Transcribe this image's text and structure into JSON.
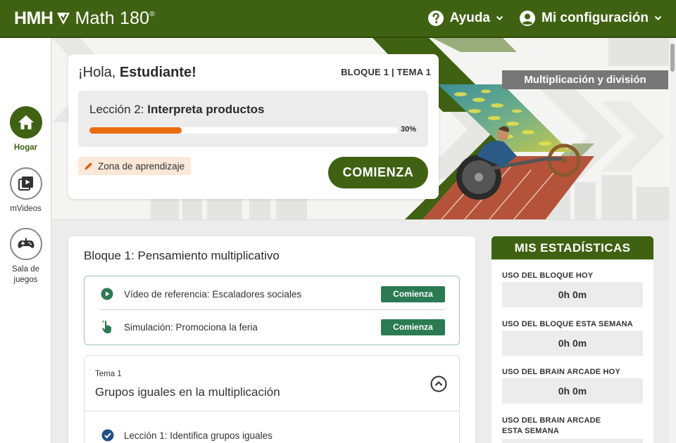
{
  "header": {
    "brand_hmh": "HMH",
    "brand_product": "Math 180",
    "brand_reg": "®",
    "help_label": "Ayuda",
    "settings_label": "Mi configuración"
  },
  "nav": {
    "items": [
      {
        "label": "Hogar",
        "icon": "home-icon"
      },
      {
        "label": "mVideos",
        "icon": "video-icon"
      },
      {
        "label": "Sala de juegos",
        "icon": "gamepad-icon"
      }
    ]
  },
  "hero": {
    "tag": "Multiplicación y división"
  },
  "welcome": {
    "greeting_prefix": "¡Hola, ",
    "student_name": "Estudiante!",
    "unit_topic": "BLOQUE 1 | TEMA 1",
    "lesson_prefix": "Lección 2: ",
    "lesson_name": "Interpreta productos",
    "progress": 30,
    "progress_label": "30%",
    "zone_label": "Zona de aprendizaje",
    "start_label": "COMIENZA"
  },
  "unit": {
    "title": "Bloque 1: Pensamiento multiplicativo",
    "references": [
      {
        "text": "Vídeo de referencia: Escaladores sociales",
        "button": "Comienza",
        "icon": "play-icon"
      },
      {
        "text": "Simulación: Promociona la feria",
        "button": "Comienza",
        "icon": "hand-pointer-icon"
      }
    ],
    "topic": {
      "number": "Tema 1",
      "name": "Grupos iguales en la multiplicación",
      "lessons": [
        {
          "text": "Lección 1: Identifica grupos iguales",
          "status": "complete"
        }
      ]
    }
  },
  "stats": {
    "title": "MIS ESTADÍSTICAS",
    "items": [
      {
        "label": "USO DEL BLOQUE HOY",
        "value": "0h 0m"
      },
      {
        "label": "USO DEL BLOQUE ESTA SEMANA",
        "value": "0h 0m"
      },
      {
        "label": "USO DEL BRAIN ARCADE HOY",
        "value": "0h 0m"
      },
      {
        "label_line1": "USO DEL BRAIN ARCADE",
        "label_line2": "ESTA SEMANA"
      }
    ]
  },
  "colors": {
    "brand_green": "#3f6212",
    "accent_orange": "#ea6b0e",
    "button_green": "#2b7a53"
  }
}
